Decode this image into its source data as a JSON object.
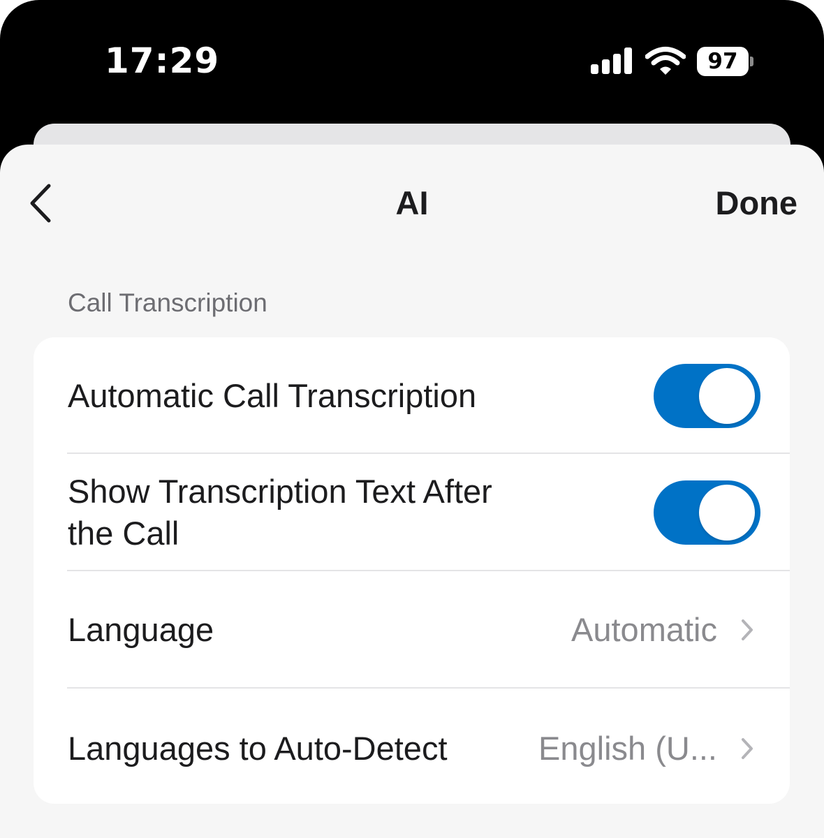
{
  "status_bar": {
    "time": "17:29",
    "battery_level": "97",
    "signal_icon": "cellular-signal-icon",
    "wifi_icon": "wifi-icon"
  },
  "nav": {
    "back_icon": "chevron-left-icon",
    "title": "AI",
    "done_label": "Done"
  },
  "section": {
    "header": "Call Transcription",
    "rows": [
      {
        "label": "Automatic Call Transcription",
        "type": "toggle",
        "on": true
      },
      {
        "label_line1": "Show Transcription Text After",
        "label_line2": "the Call",
        "type": "toggle",
        "on": true
      },
      {
        "label": "Language",
        "type": "disclosure",
        "value": "Automatic"
      },
      {
        "label": "Languages to Auto-Detect",
        "type": "disclosure",
        "value": "English (U..."
      }
    ]
  },
  "colors": {
    "toggle_on": "#0072c6",
    "sheet_background": "#f6f6f6",
    "group_background": "#ffffff",
    "secondary_text": "#8a8a8e"
  }
}
